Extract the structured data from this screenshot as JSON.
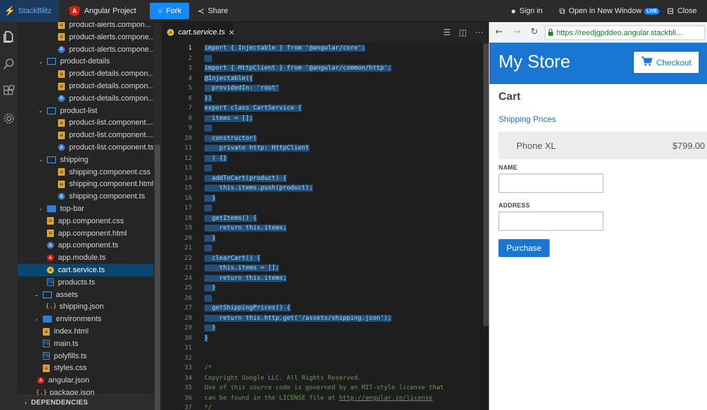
{
  "topbar": {
    "brand": "StackBlitz",
    "project": "Angular Project",
    "fork": "Fork",
    "share": "Share",
    "signin": "Sign in",
    "open_new_window": "Open in New Window",
    "live_badge": "LIVE",
    "close": "Close"
  },
  "activity_icons": [
    "files-icon",
    "search-icon",
    "extensions-icon",
    "settings-icon"
  ],
  "explorer": {
    "rows": [
      {
        "label": "product-alerts.compon...",
        "type": "css",
        "depth": 2
      },
      {
        "label": "product-alerts.compone...",
        "type": "html",
        "depth": 2
      },
      {
        "label": "product-alerts.compone...",
        "type": "comp",
        "depth": 2
      },
      {
        "label": "product-details",
        "type": "folder-open",
        "depth": 1
      },
      {
        "label": "product-details.compon...",
        "type": "css",
        "depth": 2
      },
      {
        "label": "product-details.compon...",
        "type": "html",
        "depth": 2
      },
      {
        "label": "product-details.compon...",
        "type": "comp",
        "depth": 2
      },
      {
        "label": "product-list",
        "type": "folder-open",
        "depth": 1
      },
      {
        "label": "product-list.component....",
        "type": "css",
        "depth": 2
      },
      {
        "label": "product-list.component....",
        "type": "html",
        "depth": 2
      },
      {
        "label": "product-list.component.ts",
        "type": "comp",
        "depth": 2
      },
      {
        "label": "shipping",
        "type": "folder-open",
        "depth": 1
      },
      {
        "label": "shipping.component.css",
        "type": "css",
        "depth": 2
      },
      {
        "label": "shipping.component.html",
        "type": "html",
        "depth": 2
      },
      {
        "label": "shipping.component.ts",
        "type": "comp",
        "depth": 2
      },
      {
        "label": "top-bar",
        "type": "folder-closed",
        "depth": 1
      },
      {
        "label": "app.component.css",
        "type": "css",
        "depth": 1
      },
      {
        "label": "app.component.html",
        "type": "html",
        "depth": 1
      },
      {
        "label": "app.component.ts",
        "type": "comp",
        "depth": 1
      },
      {
        "label": "app.module.ts",
        "type": "ang",
        "depth": 1
      },
      {
        "label": "cart.service.ts",
        "type": "service",
        "depth": 1,
        "selected": true
      },
      {
        "label": "products.ts",
        "type": "ts",
        "depth": 1
      },
      {
        "label": "assets",
        "type": "folder-open",
        "depth": 0
      },
      {
        "label": "shipping.json",
        "type": "json",
        "depth": 1
      },
      {
        "label": "environments",
        "type": "folder-closed",
        "depth": 0
      },
      {
        "label": "index.html",
        "type": "html",
        "depth": 0
      },
      {
        "label": "main.ts",
        "type": "ts",
        "depth": 0
      },
      {
        "label": "polyfills.ts",
        "type": "ts",
        "depth": 0
      },
      {
        "label": "styles.css",
        "type": "css",
        "depth": 0
      },
      {
        "label": "angular.json",
        "type": "ang",
        "depth": -1
      },
      {
        "label": "package.json",
        "type": "json",
        "depth": -1
      }
    ],
    "dependencies": "DEPENDENCIES"
  },
  "editor": {
    "tab_label": "cart.service.ts",
    "lines": [
      {
        "n": "1",
        "text": "import { Injectable } from '@angular/core';",
        "sel": true
      },
      {
        "n": "2",
        "text": "",
        "sel": true
      },
      {
        "n": "3",
        "text": "import { HttpClient } from '@angular/common/http';",
        "sel": true
      },
      {
        "n": "4",
        "text": "@Injectable({",
        "sel": true
      },
      {
        "n": "5",
        "text": "  providedIn: 'root'",
        "sel": true
      },
      {
        "n": "6",
        "text": "})",
        "sel": true
      },
      {
        "n": "7",
        "text": "export class CartService {",
        "sel": true
      },
      {
        "n": "8",
        "text": "  items = [];",
        "sel": true
      },
      {
        "n": "9",
        "text": "",
        "sel": true
      },
      {
        "n": "10",
        "text": "  constructor(",
        "sel": true
      },
      {
        "n": "11",
        "text": "    private http: HttpClient",
        "sel": true
      },
      {
        "n": "12",
        "text": "  ) {}",
        "sel": true
      },
      {
        "n": "13",
        "text": "",
        "sel": true
      },
      {
        "n": "14",
        "text": "  addToCart(product) {",
        "sel": true
      },
      {
        "n": "15",
        "text": "    this.items.push(product);",
        "sel": true
      },
      {
        "n": "16",
        "text": "  }",
        "sel": true
      },
      {
        "n": "17",
        "text": "",
        "sel": true
      },
      {
        "n": "18",
        "text": "  getItems() {",
        "sel": true
      },
      {
        "n": "19",
        "text": "    return this.items;",
        "sel": true
      },
      {
        "n": "20",
        "text": "  }",
        "sel": true
      },
      {
        "n": "21",
        "text": "",
        "sel": true
      },
      {
        "n": "22",
        "text": "  clearCart() {",
        "sel": true
      },
      {
        "n": "23",
        "text": "    this.items = [];",
        "sel": true
      },
      {
        "n": "24",
        "text": "    return this.items;",
        "sel": true
      },
      {
        "n": "25",
        "text": "  }",
        "sel": true
      },
      {
        "n": "26",
        "text": "",
        "sel": true
      },
      {
        "n": "27",
        "text": "  getShippingPrices() {",
        "sel": true
      },
      {
        "n": "28",
        "text": "    return this.http.get('/assets/shipping.json');",
        "sel": true
      },
      {
        "n": "29",
        "text": "  }",
        "sel": true
      },
      {
        "n": "30",
        "text": "}",
        "sel": true
      },
      {
        "n": "31",
        "text": "",
        "sel": false
      },
      {
        "n": "32",
        "text": "",
        "sel": false
      },
      {
        "n": "33",
        "text": "/*",
        "sel": false,
        "comment": true
      },
      {
        "n": "34",
        "text": "Copyright Google LLC. All Rights Reserved.",
        "sel": false,
        "comment": true
      },
      {
        "n": "35",
        "text": "Use of this source code is governed by an MIT-style license that",
        "sel": false,
        "comment": true
      },
      {
        "n": "36",
        "text": "can be found in the LICENSE file at http://angular.io/license",
        "sel": false,
        "comment": true
      },
      {
        "n": "37",
        "text": "*/",
        "sel": false,
        "comment": true
      }
    ]
  },
  "browser": {
    "url": "https://reedjgpddeo.angular.stackbli...",
    "store_title": "My Store",
    "checkout": "Checkout",
    "page_heading": "Cart",
    "shipping_link": "Shipping Prices",
    "cart_item_name": "Phone XL",
    "cart_item_price": "$799.00",
    "name_label": "NAME",
    "address_label": "ADDRESS",
    "name_value": "",
    "address_value": "",
    "purchase": "Purchase"
  },
  "colors": {
    "accent": "#1389fd",
    "store_header": "#1976d2",
    "selection": "#264f78",
    "explorer_selected": "#094771"
  }
}
